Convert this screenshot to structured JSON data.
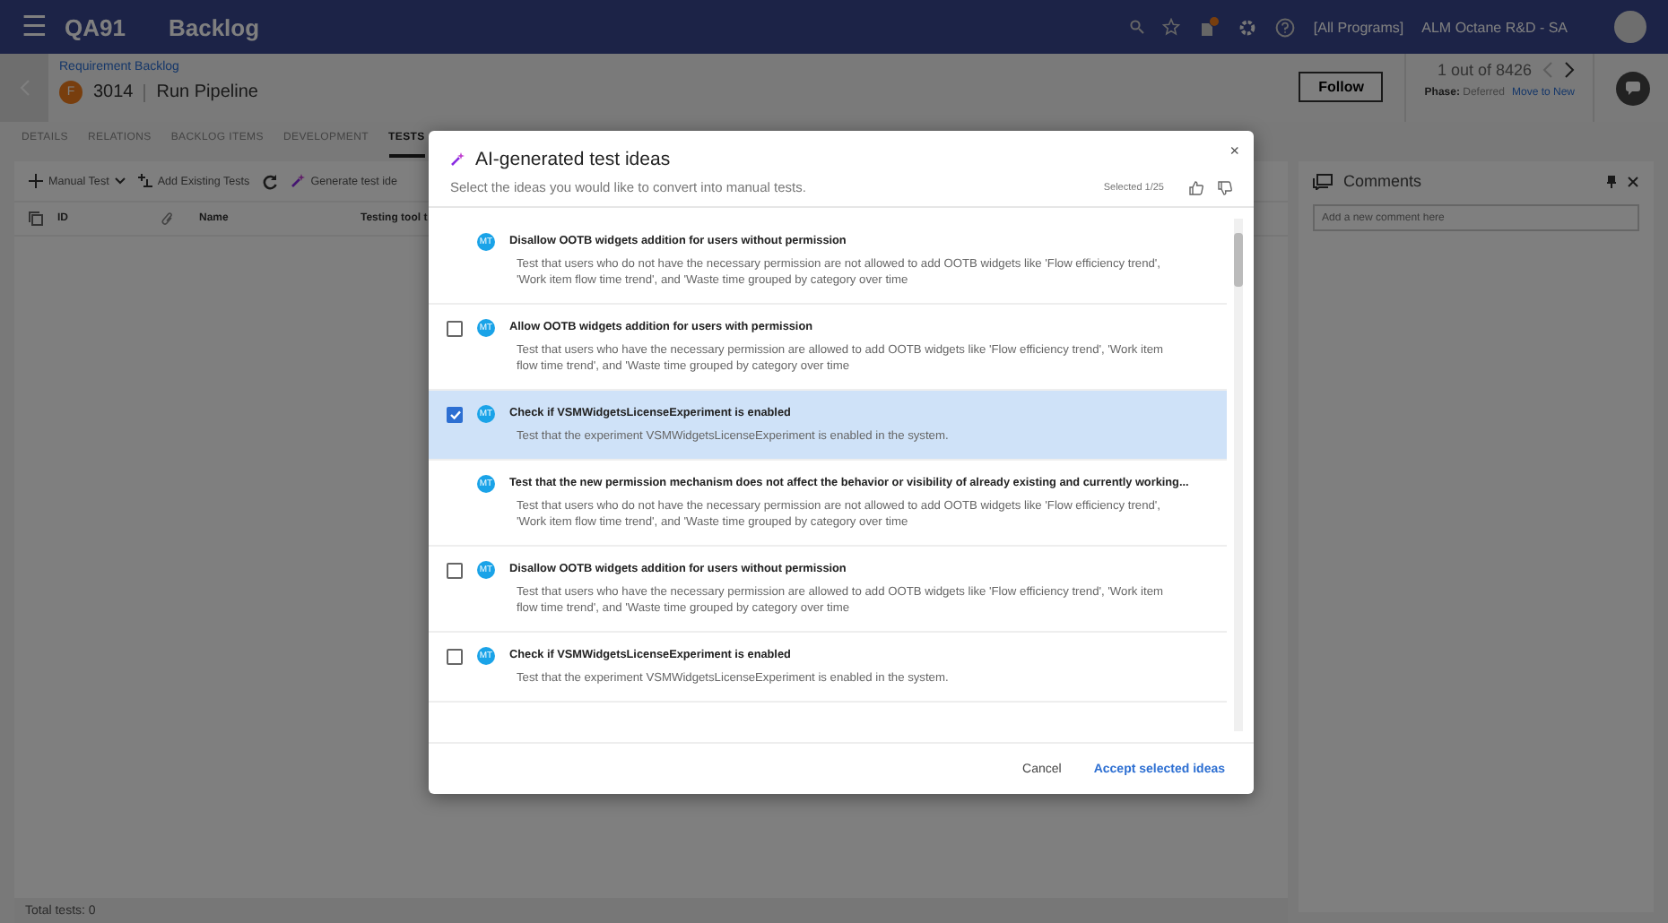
{
  "topbar": {
    "menu": "☰",
    "app": "QA91",
    "module": "Backlog",
    "programs": "[All Programs]",
    "workspace": "ALM Octane R&D - SA"
  },
  "header": {
    "breadcrumb": "Requirement Backlog",
    "badge": "F",
    "id": "3014",
    "title": "Run Pipeline",
    "follow": "Follow",
    "counter": "1 out of 8426",
    "phase_label": "Phase:",
    "phase": "Deferred",
    "action": "Move to New"
  },
  "tabs": [
    {
      "label": "DETAILS",
      "selected": false
    },
    {
      "label": "RELATIONS",
      "selected": false
    },
    {
      "label": "BACKLOG ITEMS",
      "selected": false
    },
    {
      "label": "DEVELOPMENT",
      "selected": false
    },
    {
      "label": "TESTS",
      "selected": true
    }
  ],
  "toolbar": {
    "manual": "Manual Test",
    "existing": "Add Existing Tests",
    "generate": "Generate test ide"
  },
  "table": {
    "columns": [
      "ID",
      "Name",
      "Testing tool t"
    ]
  },
  "status_bar": "Total tests: 0",
  "comments": {
    "title": "Comments",
    "placeholder": "Add a new comment here"
  },
  "dialog": {
    "title": "AI-generated test ideas",
    "subtitle": "Select the ideas you would like to convert into manual tests.",
    "selected_count": "Selected 1/25",
    "close": "×",
    "ideas": [
      {
        "kind": "plain",
        "badge": "MT",
        "title": "Disallow OOTB widgets addition for users without permission",
        "description": "Test that users who do not have the necessary permission are not allowed to add OOTB widgets like 'Flow efficiency trend', 'Work item flow time trend', and 'Waste time grouped by category over time"
      },
      {
        "kind": "checkbox",
        "checked": false,
        "badge": "MT",
        "title": "Allow OOTB widgets addition for users with permission",
        "description": "Test that users who have the necessary permission are allowed to add OOTB widgets like 'Flow efficiency trend', 'Work item flow time trend', and 'Waste time grouped by category over time"
      },
      {
        "kind": "checkbox",
        "checked": true,
        "badge": "MT",
        "title": "Check if VSMWidgetsLicenseExperiment is enabled",
        "description": "Test that the experiment VSMWidgetsLicenseExperiment is enabled in the system."
      },
      {
        "kind": "plain",
        "badge": "MT",
        "title": "Test that the new permission mechanism does not affect the behavior or visibility of already existing and currently working...",
        "description": "Test that users who do not have the necessary permission are not allowed to add OOTB widgets like 'Flow efficiency trend', 'Work item flow time trend', and 'Waste time grouped by category over time"
      },
      {
        "kind": "checkbox",
        "checked": false,
        "badge": "MT",
        "title": "Disallow OOTB widgets addition for users without permission",
        "description": "Test that users who have the necessary permission are allowed to add OOTB widgets like 'Flow efficiency trend', 'Work item flow time trend', and 'Waste time grouped by category over time"
      },
      {
        "kind": "checkbox",
        "checked": false,
        "badge": "MT",
        "title": "Check if VSMWidgetsLicenseExperiment is enabled",
        "description": "Test that the experiment VSMWidgetsLicenseExperiment is enabled in the system."
      }
    ],
    "buttons": {
      "cancel": "Cancel",
      "accept": "Accept selected ideas"
    }
  }
}
